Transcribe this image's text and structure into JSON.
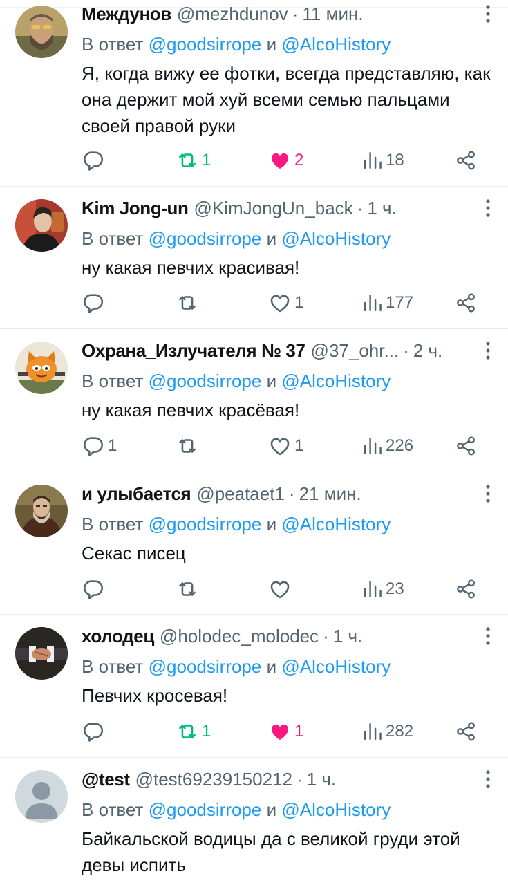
{
  "reply_prefix": "В ответ",
  "reply_and": "и",
  "tweets": [
    {
      "name": "Междунов",
      "handle": "@mezhdunov",
      "time": "11 мин.",
      "mention1": "@goodsirrope",
      "mention2": "@AlcoHistory",
      "text": "Я, когда вижу ее фотки, всегда представляю, как она держит мой хуй всеми семью пальцами своей правой руки",
      "replies": "",
      "retweets": "1",
      "likes": "2",
      "views": "18",
      "retweeted": true,
      "liked": true,
      "avatar_icon": "bearded-man-avatar"
    },
    {
      "name": "Kim Jong-un",
      "handle": "@KimJongUn_back",
      "time": "1 ч.",
      "mention1": "@goodsirrope",
      "mention2": "@AlcoHistory",
      "text": "ну какая певчих красивая!",
      "replies": "",
      "retweets": "",
      "likes": "1",
      "views": "177",
      "retweeted": false,
      "liked": false,
      "avatar_icon": "man-in-black-avatar"
    },
    {
      "name": "Охрана_Излучателя № 37",
      "handle": "@37_ohr...",
      "time": "2 ч.",
      "mention1": "@goodsirrope",
      "mention2": "@AlcoHistory",
      "text": "ну какая певчих красёвая!",
      "replies": "1",
      "retweets": "",
      "likes": "1",
      "views": "226",
      "retweeted": false,
      "liked": false,
      "avatar_icon": "cartoon-cat-avatar"
    },
    {
      "name": "и улыбается",
      "handle": "@peataet1",
      "time": "21 мин.",
      "mention1": "@goodsirrope",
      "mention2": "@AlcoHistory",
      "text": "Секас писец",
      "replies": "",
      "retweets": "",
      "likes": "",
      "views": "23",
      "retweeted": false,
      "liked": false,
      "avatar_icon": "portrait-painting-avatar"
    },
    {
      "name": "холодец",
      "handle": "@holodec_molodec",
      "time": "1 ч.",
      "mention1": "@goodsirrope",
      "mention2": "@AlcoHistory",
      "text": "Певчих кросевая!",
      "replies": "",
      "retweets": "1",
      "likes": "1",
      "views": "282",
      "retweeted": true,
      "liked": true,
      "avatar_icon": "handshake-avatar"
    },
    {
      "name": "@test",
      "handle": "@test69239150212",
      "time": "1 ч.",
      "mention1": "@goodsirrope",
      "mention2": "@AlcoHistory",
      "text": "Байкальской водицы да с великой груди этой девы испить",
      "replies": "",
      "retweets": "",
      "likes": "",
      "views": "",
      "retweeted": false,
      "liked": false,
      "avatar_icon": "default-user-avatar"
    }
  ],
  "colors": {
    "text": "#0f1419",
    "muted": "#536471",
    "link": "#1d9bf0",
    "retweet": "#00ba7c",
    "like": "#f91880",
    "divider": "#e6ecf0"
  }
}
